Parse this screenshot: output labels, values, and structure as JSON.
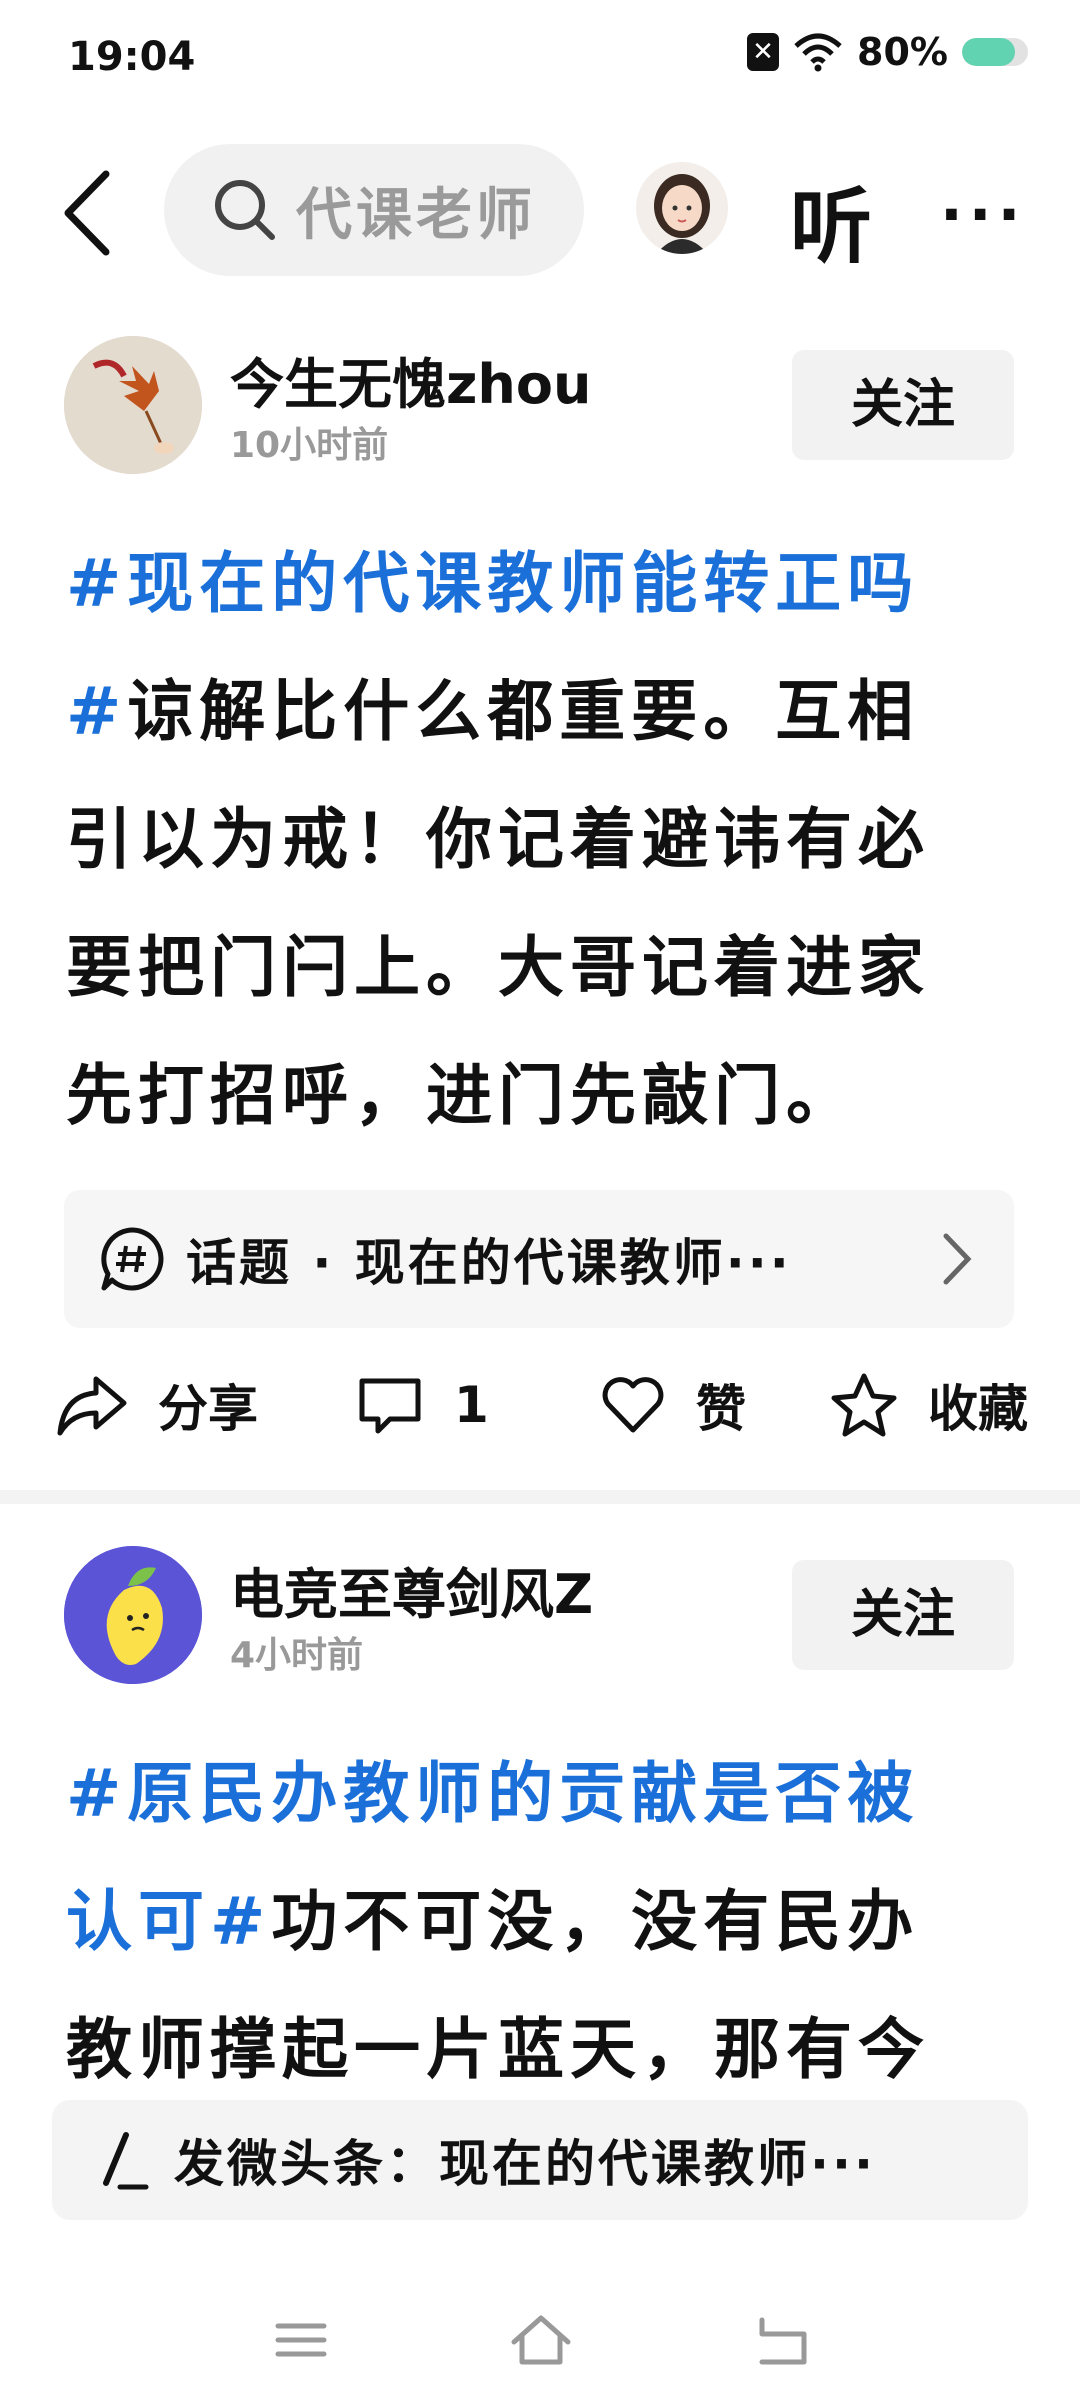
{
  "status_bar": {
    "time": "19:04",
    "battery": "80%",
    "battery_level": 0.8
  },
  "top_bar": {
    "search_placeholder": "代课老师",
    "listen_label": "听",
    "more_label": "···"
  },
  "posts": [
    {
      "author": "今生无愧zhou",
      "time": "10小时前",
      "follow_label": "关注",
      "text_lines": [
        {
          "tag": "#现在的代课教师能转正吗",
          "text": ""
        },
        {
          "tag": "#",
          "text": "谅解比什么都重要。互相"
        },
        {
          "tag": "",
          "text": "引以为戒！你记着避讳有必"
        },
        {
          "tag": "",
          "text": "要把门闩上。大哥记着进家"
        },
        {
          "tag": "",
          "text": "先打招呼，进门先敲门。"
        }
      ],
      "topic": "话题 · 现在的代课教师···",
      "actions": {
        "share": "分享",
        "comment_count": "1",
        "like": "赞",
        "collect": "收藏"
      }
    },
    {
      "author": "电竞至尊剑风Z",
      "time": "4小时前",
      "follow_label": "关注",
      "text_lines": [
        {
          "tag": "#原民办教师的贡献是否被",
          "text": ""
        },
        {
          "tag": "认可#",
          "text": "功不可没，没有民办"
        },
        {
          "tag": "",
          "text": "教师撑起一片蓝天，那有今"
        }
      ]
    }
  ],
  "compose": {
    "text": "发微头条：现在的代课教师···"
  },
  "colors": {
    "accent": "#1a6fd8",
    "battery": "#62d3b0"
  }
}
